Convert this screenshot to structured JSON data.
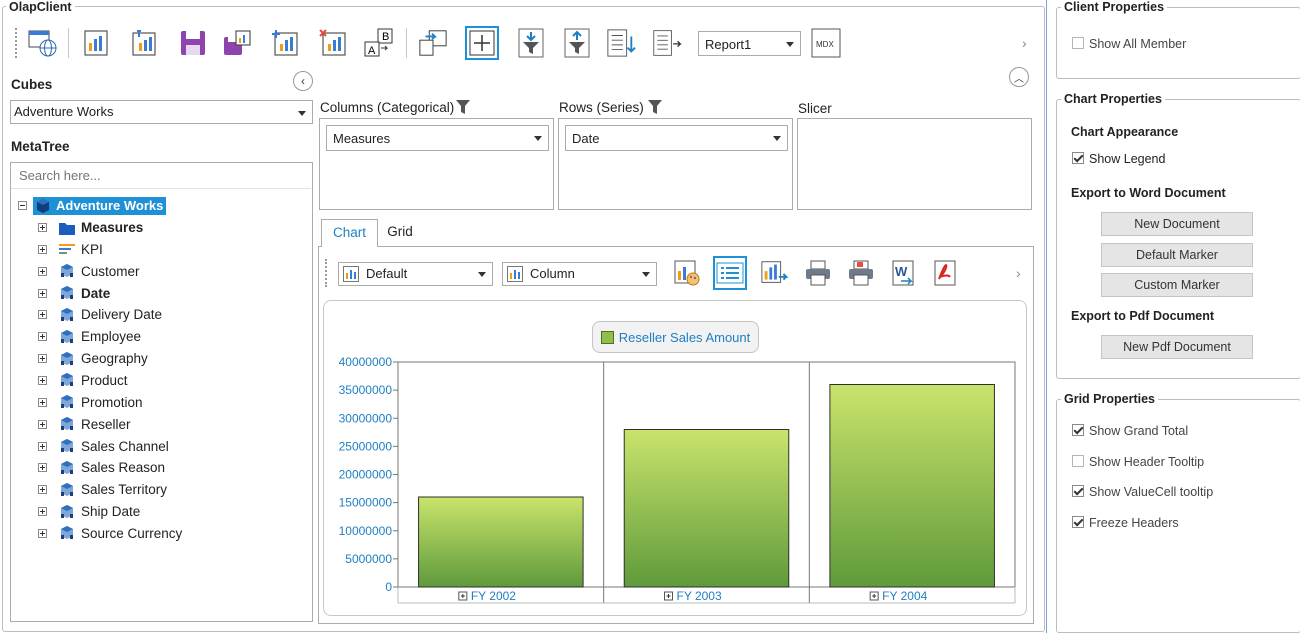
{
  "olap": {
    "title": "OlapClient",
    "report_select": "Report1",
    "mdx_label": "MDX"
  },
  "cubes": {
    "heading": "Cubes",
    "selected": "Adventure Works"
  },
  "metatree": {
    "heading": "MetaTree",
    "search_placeholder": "Search here...",
    "root": "Adventure Works",
    "items": [
      {
        "label": "Measures",
        "bold": true,
        "icon": "folder-icon"
      },
      {
        "label": "KPI",
        "bold": false,
        "icon": "kpi-icon"
      },
      {
        "label": "Customer",
        "bold": false,
        "icon": "dimension-icon"
      },
      {
        "label": "Date",
        "bold": true,
        "icon": "dimension-icon"
      },
      {
        "label": "Delivery Date",
        "bold": false,
        "icon": "dimension-icon"
      },
      {
        "label": "Employee",
        "bold": false,
        "icon": "dimension-icon"
      },
      {
        "label": "Geography",
        "bold": false,
        "icon": "dimension-icon"
      },
      {
        "label": "Product",
        "bold": false,
        "icon": "dimension-icon"
      },
      {
        "label": "Promotion",
        "bold": false,
        "icon": "dimension-icon"
      },
      {
        "label": "Reseller",
        "bold": false,
        "icon": "dimension-icon"
      },
      {
        "label": "Sales Channel",
        "bold": false,
        "icon": "dimension-icon"
      },
      {
        "label": "Sales Reason",
        "bold": false,
        "icon": "dimension-icon"
      },
      {
        "label": "Sales Territory",
        "bold": false,
        "icon": "dimension-icon"
      },
      {
        "label": "Ship Date",
        "bold": false,
        "icon": "dimension-icon"
      },
      {
        "label": "Source Currency",
        "bold": false,
        "icon": "dimension-icon"
      }
    ]
  },
  "axes": {
    "columns_label": "Columns (Categorical)",
    "columns_value": "Measures",
    "rows_label": "Rows (Series)",
    "rows_value": "Date",
    "slicer_label": "Slicer"
  },
  "tabs": {
    "chart": "Chart",
    "grid": "Grid"
  },
  "chart_toolbar": {
    "skin": "Default",
    "type": "Column"
  },
  "chart_data": {
    "type": "bar",
    "categories": [
      "FY 2002",
      "FY 2003",
      "FY 2004"
    ],
    "series": [
      {
        "name": "Reseller Sales Amount",
        "values": [
          16000000,
          28000000,
          36000000
        ]
      }
    ],
    "ylim": [
      0,
      40000000
    ],
    "yticks": [
      "40000000",
      "35000000",
      "30000000",
      "25000000",
      "20000000",
      "15000000",
      "10000000",
      "5000000",
      "0"
    ],
    "legend": "top",
    "grid": true,
    "bar_color": "#8fc14a"
  },
  "client_props": {
    "title": "Client Properties",
    "show_all_member": "Show All Member",
    "show_all_member_checked": false
  },
  "chart_props": {
    "title": "Chart Properties",
    "appearance": "Chart Appearance",
    "show_legend": "Show Legend",
    "show_legend_checked": true,
    "export_word": "Export to Word Document",
    "new_document": "New Document",
    "default_marker": "Default Marker",
    "custom_marker": "Custom Marker",
    "export_pdf": "Export to Pdf Document",
    "new_pdf": "New Pdf Document"
  },
  "grid_props": {
    "title": "Grid Properties",
    "options": [
      {
        "label": "Show Grand Total",
        "checked": true
      },
      {
        "label": "Show Header Tooltip",
        "checked": false
      },
      {
        "label": "Show ValueCell tooltip",
        "checked": true
      },
      {
        "label": "Freeze Headers",
        "checked": true
      }
    ]
  }
}
